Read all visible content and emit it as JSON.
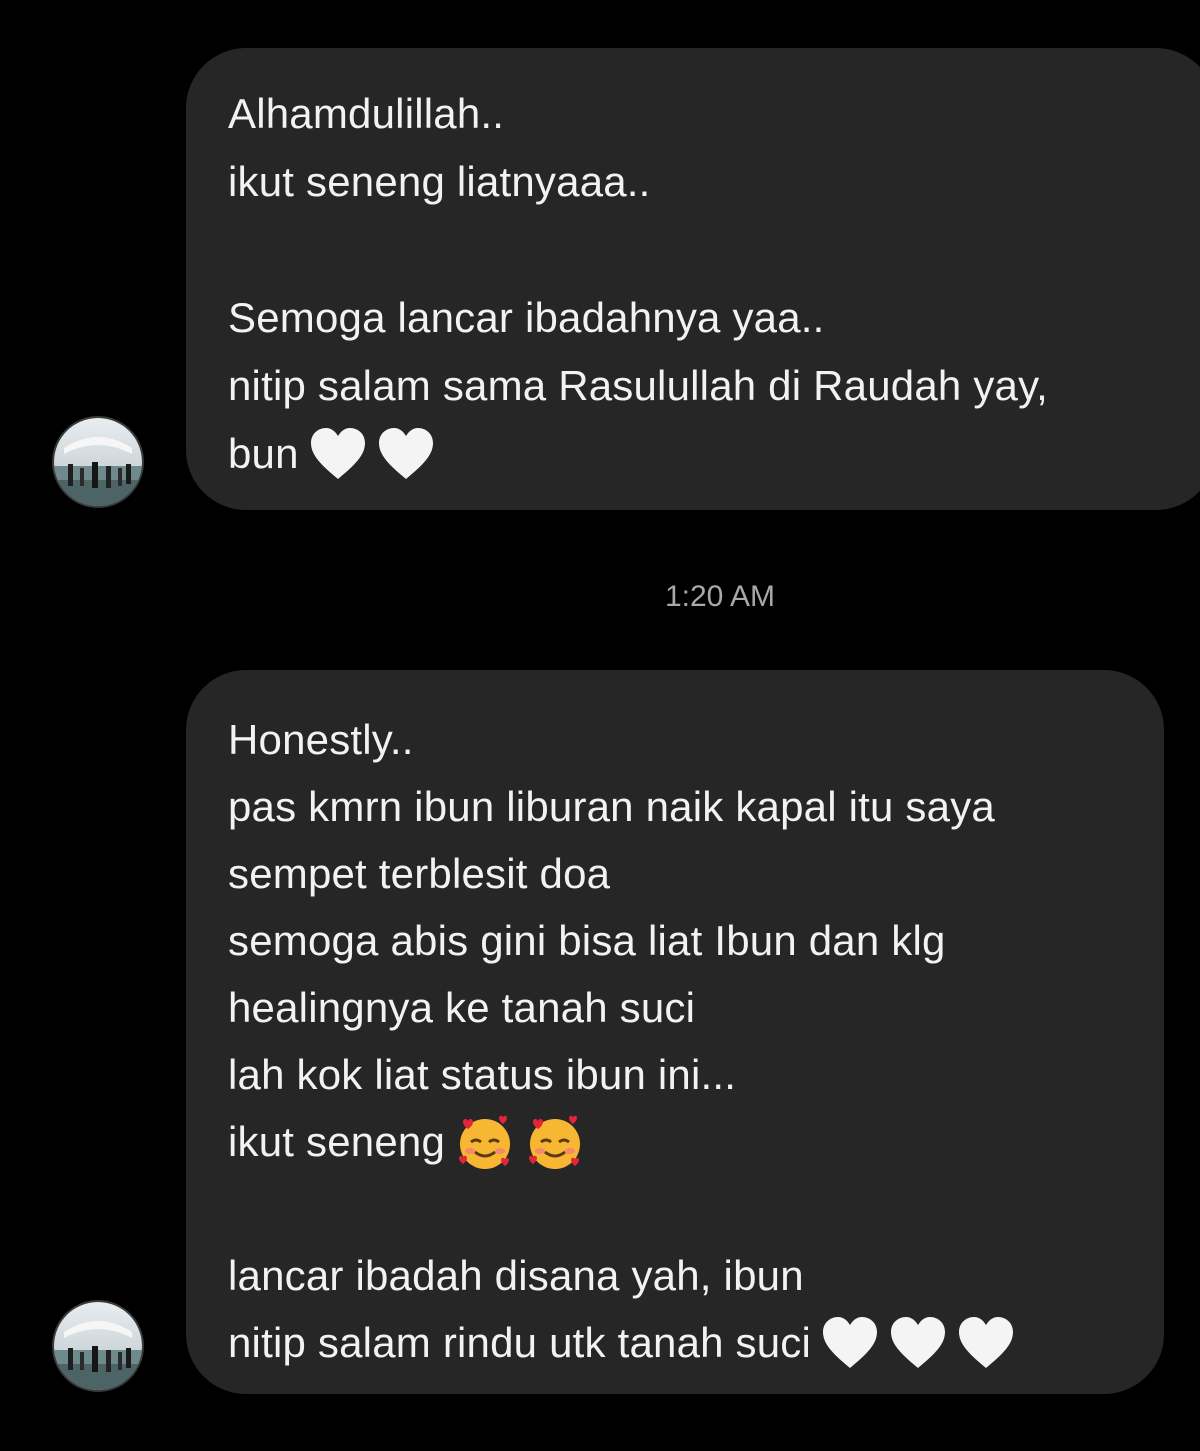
{
  "conversation": {
    "message_1": {
      "lines": [
        "Alhamdulillah..",
        "ikut seneng liatnyaaa..",
        "",
        "Semoga lancar ibadahnya yaa..",
        "nitip salam sama Rasulullah di Raudah yay,",
        "bun"
      ],
      "trailing_icons": [
        "white-heart",
        "white-heart"
      ]
    },
    "timestamp": "1:20 AM",
    "message_2": {
      "lines": [
        "Honestly..",
        "pas kmrn ibun liburan naik kapal itu saya",
        "sempet terblesit doa",
        "semoga abis gini bisa liat Ibun dan klg",
        "healingnya ke tanah suci",
        "lah kok liat status ibun ini...",
        "ikut seneng",
        "",
        "lancar ibadah disana yah, ibun",
        "nitip salam rindu utk tanah suci"
      ],
      "line7_icons": [
        "smiling-face-with-hearts",
        "smiling-face-with-hearts"
      ],
      "line10_icons": [
        "white-heart",
        "white-heart",
        "white-heart"
      ]
    },
    "colors": {
      "background": "#000000",
      "bubble": "#262626",
      "text": "#f2f2f2",
      "timestamp": "#a8a8a8"
    }
  }
}
